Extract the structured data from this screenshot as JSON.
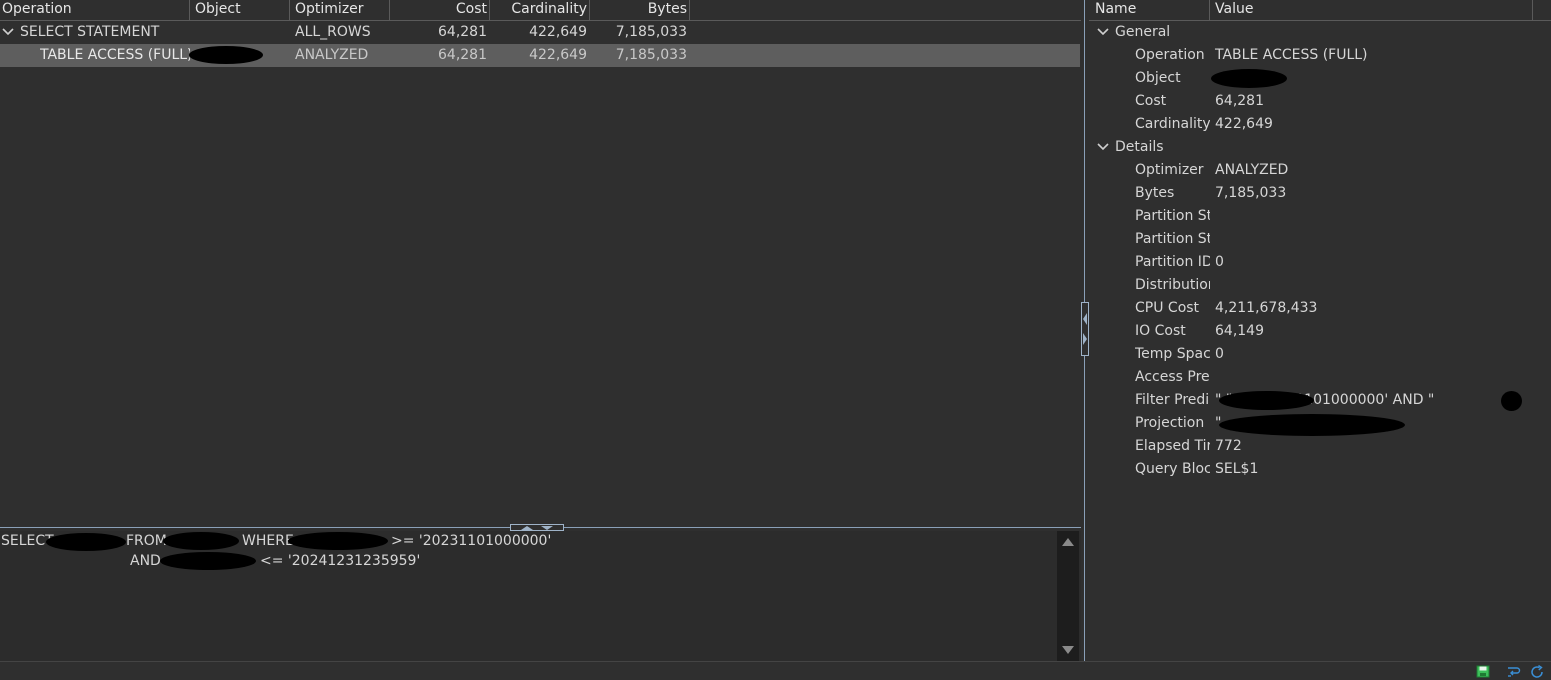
{
  "plan_grid": {
    "columns": [
      "Operation",
      "Object",
      "Optimizer",
      "Cost",
      "Cardinality",
      "Bytes"
    ],
    "rows": [
      {
        "operation": "SELECT STATEMENT",
        "object": "",
        "optimizer": "ALL_ROWS",
        "cost": "64,281",
        "cardinality": "422,649",
        "bytes": "7,185,033",
        "expanded": true,
        "selected": false
      },
      {
        "operation": "TABLE ACCESS (FULL)",
        "object": "",
        "optimizer": "ANALYZED",
        "cost": "64,281",
        "cardinality": "422,649",
        "bytes": "7,185,033",
        "expanded": false,
        "selected": true
      }
    ]
  },
  "sql_text": {
    "select_kw": "SELECT",
    "from_kw": "FROM",
    "where_kw": "WHERE",
    "cond1": ">=  '20231101000000'",
    "and_kw": "AND",
    "cond2": "<=  '20241231235959'"
  },
  "properties": {
    "columns": [
      "Name",
      "Value"
    ],
    "groups": [
      {
        "label": "General",
        "items": [
          {
            "name": "Operation",
            "value": "TABLE ACCESS (FULL)"
          },
          {
            "name": "Object",
            "value": ""
          },
          {
            "name": "Cost",
            "value": "64,281"
          },
          {
            "name": "Cardinality",
            "value": "422,649"
          }
        ]
      },
      {
        "label": "Details",
        "items": [
          {
            "name": "Optimizer",
            "value": "ANALYZED"
          },
          {
            "name": "Bytes",
            "value": "7,185,033"
          },
          {
            "name": "Partition St",
            "value": ""
          },
          {
            "name": "Partition St",
            "value": ""
          },
          {
            "name": "Partition ID",
            "value": "0"
          },
          {
            "name": "Distribution",
            "value": ""
          },
          {
            "name": "CPU Cost",
            "value": "4,211,678,433"
          },
          {
            "name": "IO Cost",
            "value": "64,149"
          },
          {
            "name": "Temp Space",
            "value": "0"
          },
          {
            "name": "Access Pred",
            "value": ""
          },
          {
            "name": "Filter Predi",
            "value": "\"                 \">='20231101000000' AND \""
          },
          {
            "name": "Projection",
            "value": "\""
          },
          {
            "name": "Elapsed Tir",
            "value": "772"
          },
          {
            "name": "Query Bloc",
            "value": "SEL$1"
          }
        ]
      }
    ]
  },
  "icons": {
    "save": "save-icon",
    "wrap": "word-wrap-icon",
    "refresh": "refresh-icon"
  },
  "colors": {
    "background": "#2f2f2f",
    "selected_row": "#5e5e5e",
    "text": "#d6d6d6",
    "splitter": "#8aa0b8",
    "save_icon": "#3cbf5a",
    "tool_icon": "#3a8fd6"
  }
}
